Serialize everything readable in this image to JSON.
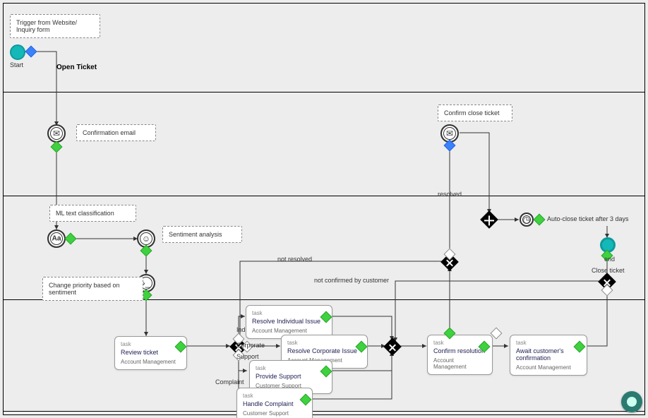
{
  "notes": {
    "trigger": "Trigger from Website/ Inquiry form",
    "confirmation_email": "Confirmation email",
    "ml_classification": "ML text classification",
    "sentiment_analysis": "Sentiment analysis",
    "change_priority": "Change priority based on sentiment",
    "confirm_close": "Confirm close ticket"
  },
  "labels": {
    "start": "Start",
    "end": "end",
    "open_ticket": "Open Ticket",
    "individual": "Individual",
    "corporate": "Corporate",
    "support": "Support",
    "complaint": "Complaint",
    "resolved": "resolved",
    "not_resolved": "not resolved",
    "not_confirmed": "not confirmed by customer",
    "auto_close": "Auto-close ticket after 3 days",
    "close_ticket": "Close ticket"
  },
  "tasks": {
    "review": {
      "label": "task",
      "name": "Review ticket",
      "role": "Account Management"
    },
    "resolve_ind": {
      "label": "task",
      "name": "Resolve Individual Issue",
      "role": "Account Management"
    },
    "resolve_corp": {
      "label": "task",
      "name": "Resolve Corporate Issue",
      "role": "Account Management"
    },
    "provide_support": {
      "label": "task",
      "name": "Provide Support",
      "role": "Customer Support"
    },
    "handle_complaint": {
      "label": "task",
      "name": "Handle Complaint",
      "role": "Customer Support"
    },
    "confirm_res": {
      "label": "task",
      "name": "Confirm resolution",
      "role": "Account Management"
    },
    "await_conf": {
      "label": "task",
      "name": "Await customer's confirmation",
      "role": "Account Management"
    }
  }
}
